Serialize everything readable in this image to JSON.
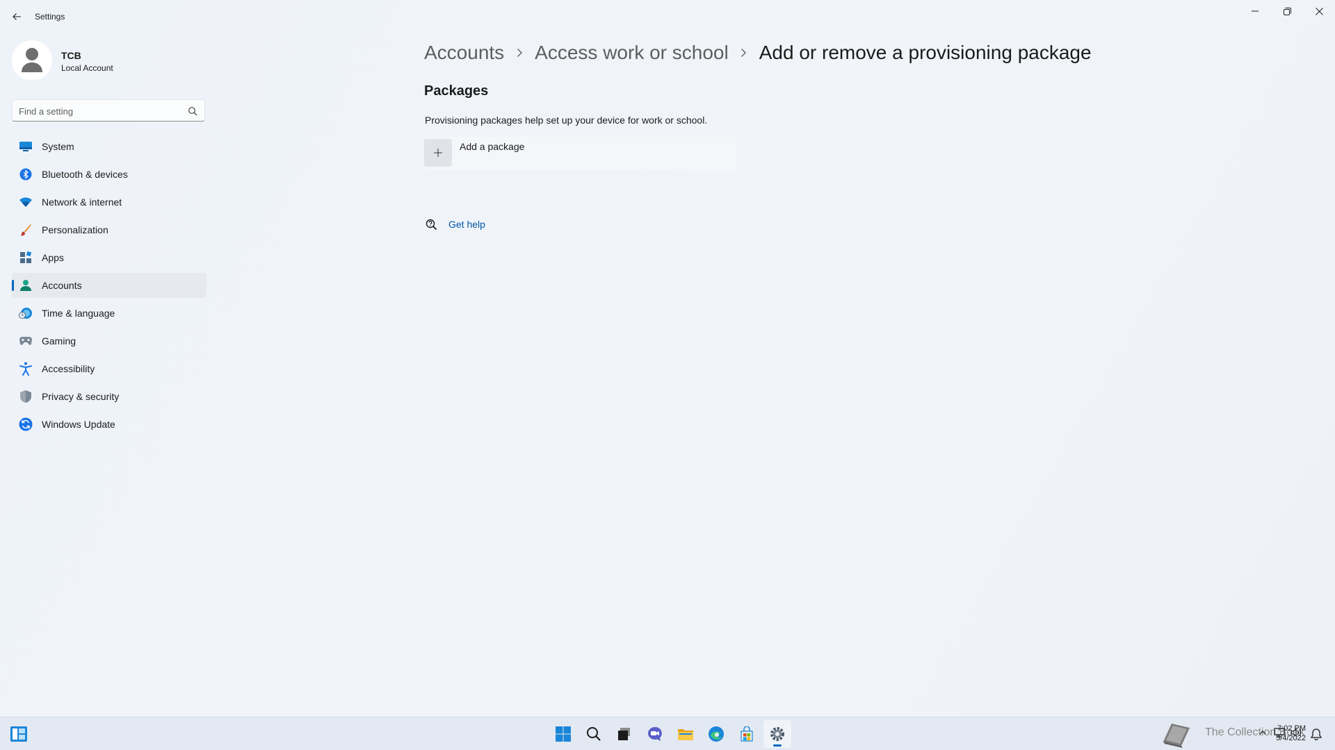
{
  "app": {
    "title": "Settings"
  },
  "profile": {
    "name": "TCB",
    "subtitle": "Local Account"
  },
  "search": {
    "placeholder": "Find a setting"
  },
  "sidebar": {
    "items": [
      {
        "label": "System",
        "icon": "monitor-icon"
      },
      {
        "label": "Bluetooth & devices",
        "icon": "bluetooth-icon"
      },
      {
        "label": "Network & internet",
        "icon": "wifi-icon"
      },
      {
        "label": "Personalization",
        "icon": "brush-icon"
      },
      {
        "label": "Apps",
        "icon": "apps-icon"
      },
      {
        "label": "Accounts",
        "icon": "person-icon",
        "active": true
      },
      {
        "label": "Time & language",
        "icon": "globe-clock-icon"
      },
      {
        "label": "Gaming",
        "icon": "controller-icon"
      },
      {
        "label": "Accessibility",
        "icon": "accessibility-icon"
      },
      {
        "label": "Privacy & security",
        "icon": "shield-icon"
      },
      {
        "label": "Windows Update",
        "icon": "update-icon"
      }
    ]
  },
  "breadcrumb": {
    "items": [
      "Accounts",
      "Access work or school"
    ],
    "current": "Add or remove a provisioning package"
  },
  "main": {
    "section_title": "Packages",
    "description": "Provisioning packages help set up your device for work or school.",
    "add_label": "Add a package",
    "help_label": "Get help"
  },
  "taskbar": {
    "watermark": "The Collection Book",
    "time": "7:02 PM",
    "date": "5/4/2022"
  },
  "colors": {
    "accent": "#0067c0",
    "link": "#0055a4"
  }
}
